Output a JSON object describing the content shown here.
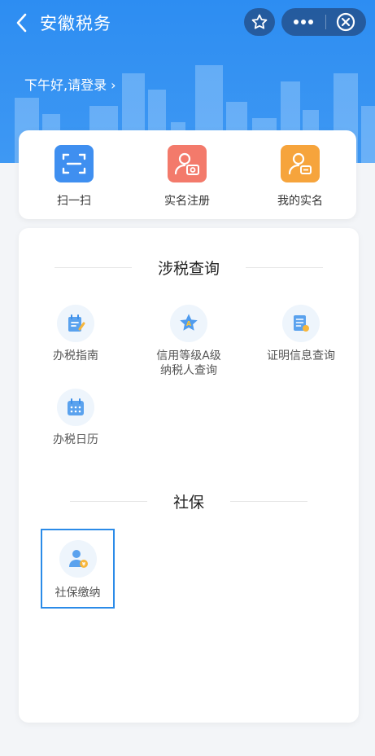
{
  "nav": {
    "title": "安徽税务"
  },
  "header": {
    "greeting": "下午好,请登录 ›"
  },
  "quick_actions": [
    {
      "label": "扫一扫",
      "icon": "scan-icon",
      "color": "#3f8ff0"
    },
    {
      "label": "实名注册",
      "icon": "camera-user-icon",
      "color": "#f37a6b"
    },
    {
      "label": "我的实名",
      "icon": "user-card-icon",
      "color": "#f6a43c"
    }
  ],
  "sections": {
    "tax_query": {
      "title": "涉税查询",
      "items": [
        {
          "label": "办税指南",
          "icon": "guide-icon"
        },
        {
          "label_line1": "信用等级A级",
          "label_line2": "纳税人查询",
          "icon": "star-a-icon"
        },
        {
          "label": "证明信息查询",
          "icon": "certificate-icon"
        },
        {
          "label": "办税日历",
          "icon": "calendar-icon"
        }
      ]
    },
    "social_security": {
      "title": "社保",
      "items": [
        {
          "label": "社保缴纳",
          "icon": "user-coin-icon"
        }
      ]
    }
  },
  "colors": {
    "primary": "#2d8df2",
    "selected_border": "#2b8be8",
    "icon_blue": "#3b8eea"
  }
}
